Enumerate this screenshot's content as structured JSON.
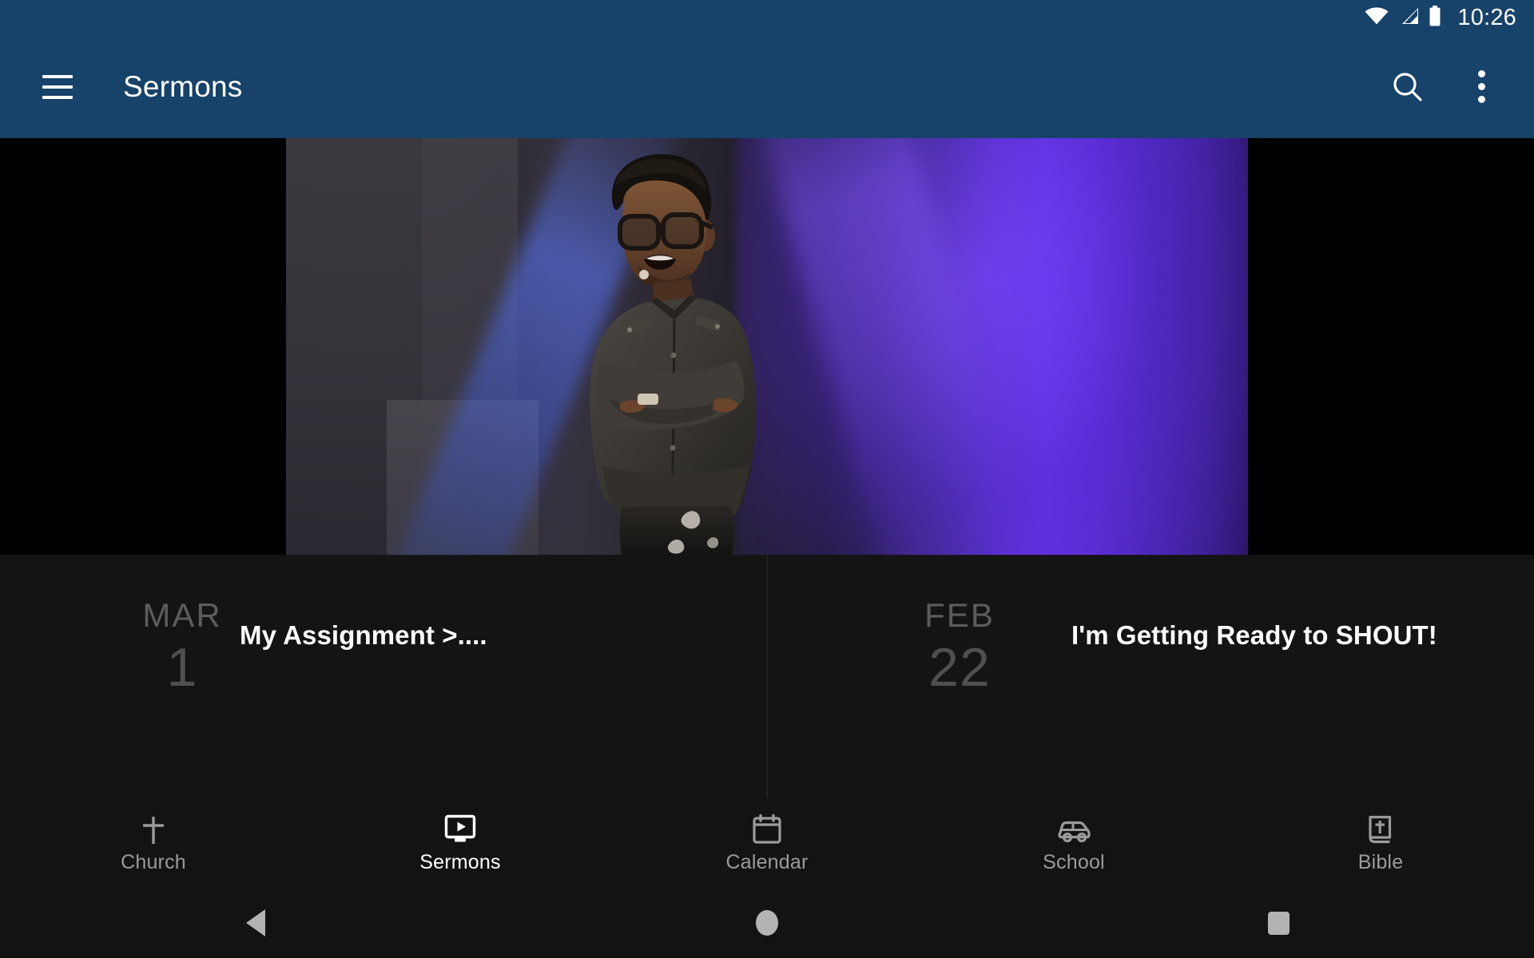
{
  "status_bar": {
    "time": "10:26",
    "icons": [
      "wifi-icon",
      "cellular-signal-icon",
      "battery-icon"
    ],
    "background_color": "#174269"
  },
  "app_bar": {
    "title": "Sermons",
    "menu_icon": "hamburger-menu-icon",
    "search_icon": "search-icon",
    "overflow_icon": "overflow-menu-icon",
    "background_color": "#174269",
    "text_color": "#ffffff"
  },
  "video_player": {
    "description": "speaker-on-stage-video",
    "letterbox_color": "#000000",
    "accent_light_color": "#6634e8"
  },
  "sermon_list": {
    "items": [
      {
        "month": "MAR",
        "day": "1",
        "title": "My Assignment >...."
      },
      {
        "month": "FEB",
        "day": "22",
        "title": "I'm Getting Ready to SHOUT!"
      }
    ],
    "background_color": "#141414",
    "date_color": "#5c5c5c",
    "title_color": "#ffffff"
  },
  "bottom_nav": {
    "active_index": 1,
    "active_color": "#ffffff",
    "inactive_color": "#9b9b9b",
    "items": [
      {
        "label": "Church",
        "icon": "cross-icon"
      },
      {
        "label": "Sermons",
        "icon": "video-monitor-icon"
      },
      {
        "label": "Calendar",
        "icon": "calendar-icon"
      },
      {
        "label": "School",
        "icon": "car-icon"
      },
      {
        "label": "Bible",
        "icon": "bible-book-icon"
      }
    ]
  },
  "system_nav": {
    "back": "back-triangle-icon",
    "home": "home-circle-icon",
    "recents": "recents-square-icon",
    "icon_color": "#b3b3b3"
  }
}
